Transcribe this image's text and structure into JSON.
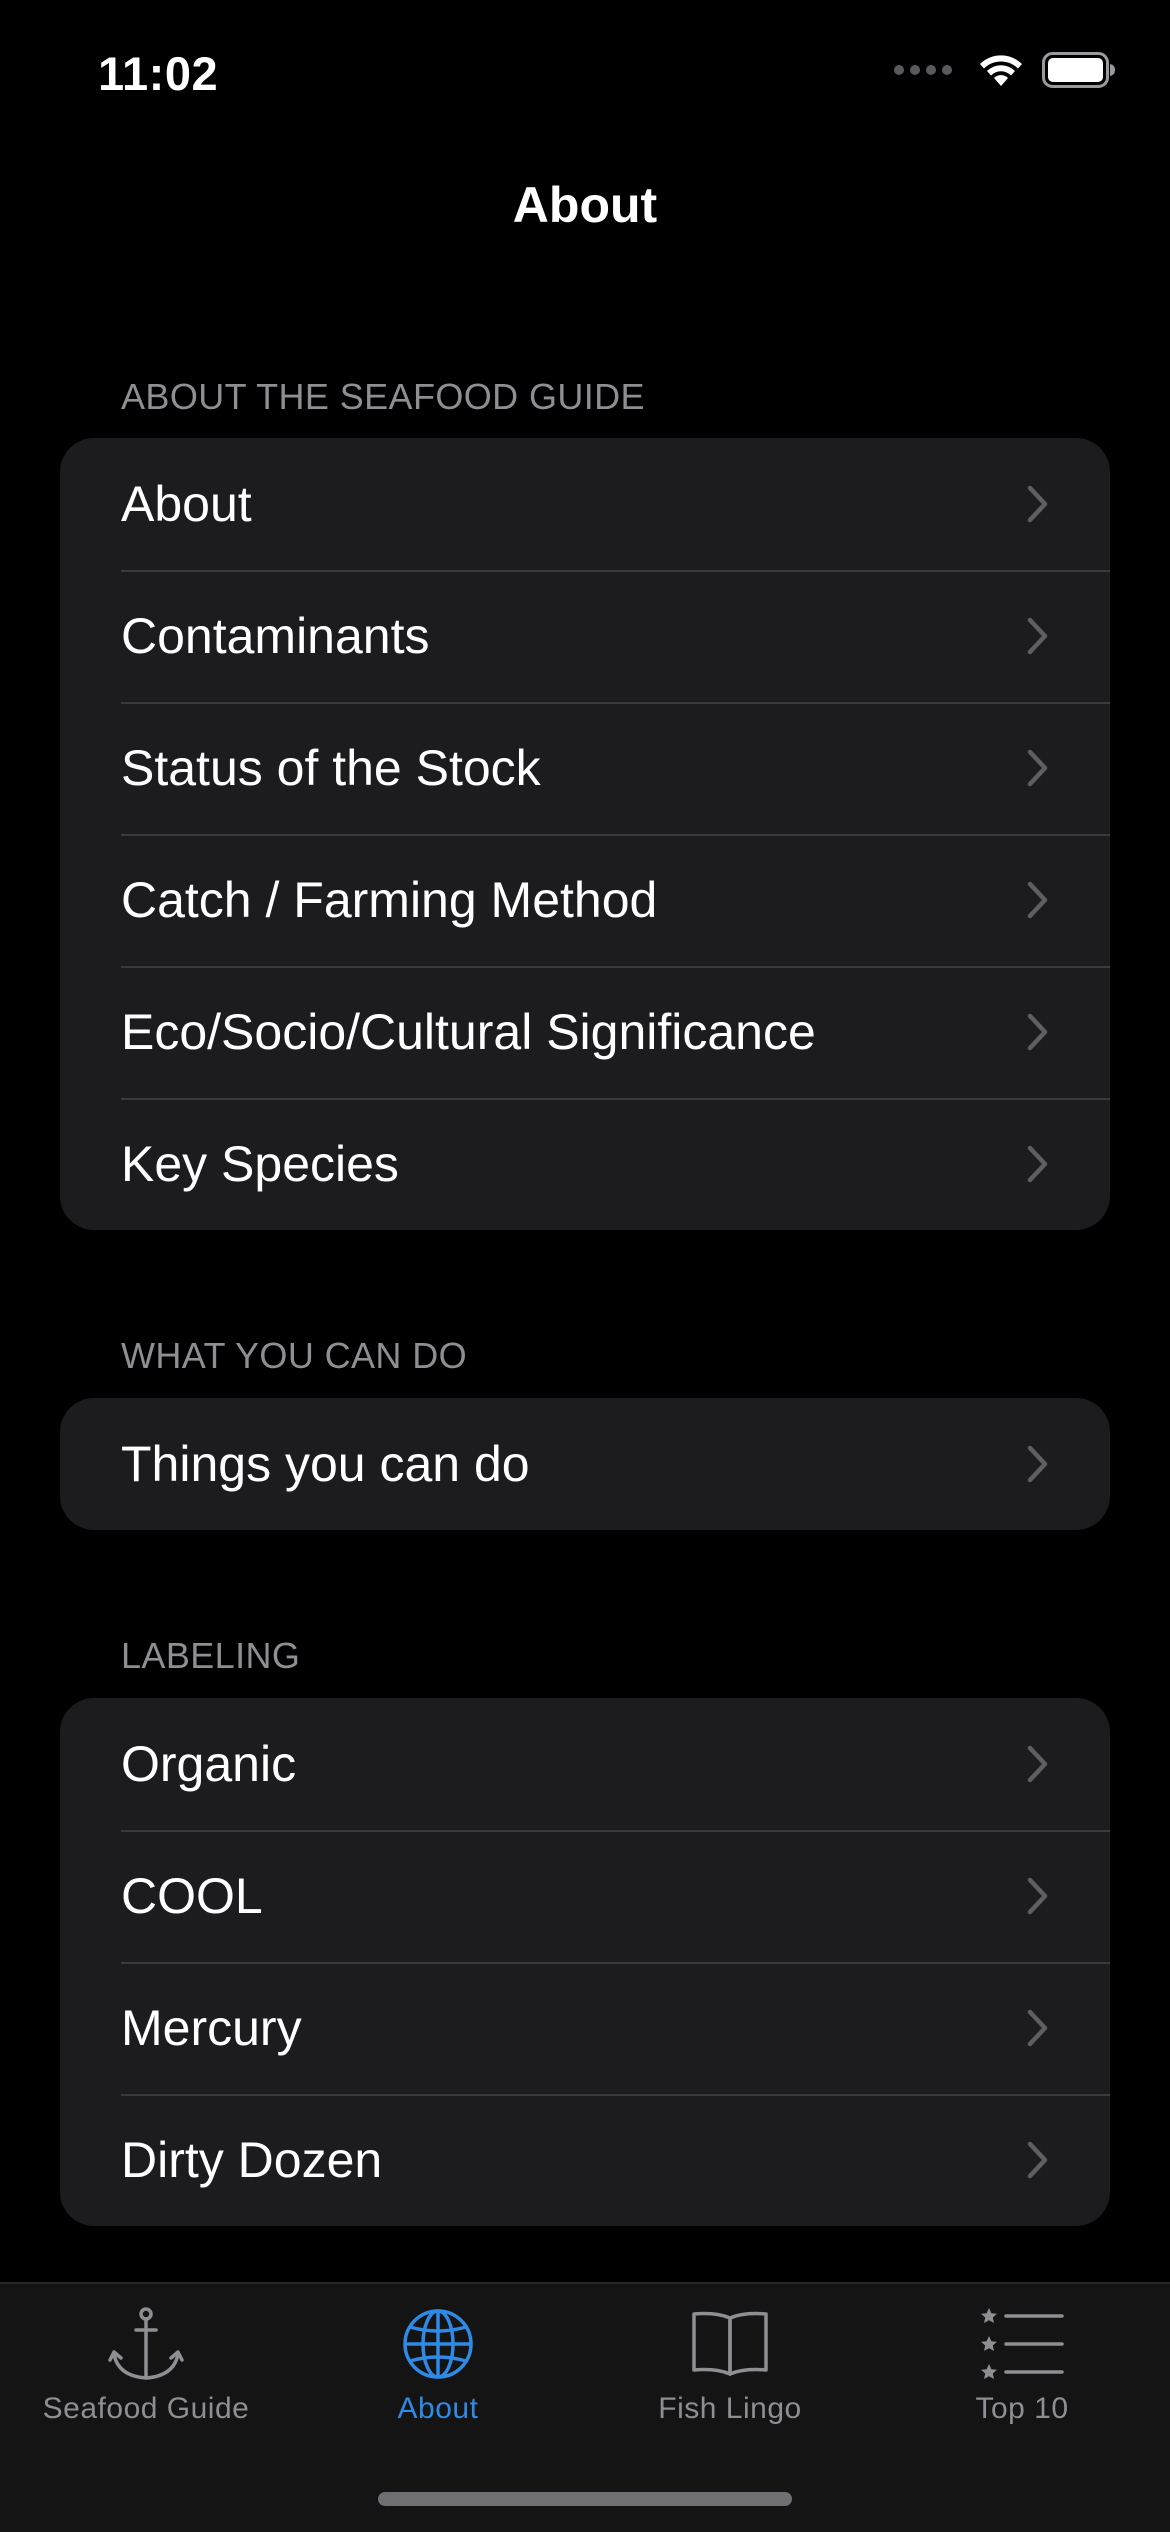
{
  "status_bar": {
    "time": "11:02"
  },
  "nav": {
    "title": "About"
  },
  "sections": [
    {
      "header": "ABOUT THE SEAFOOD GUIDE",
      "items": [
        {
          "label": "About"
        },
        {
          "label": "Contaminants"
        },
        {
          "label": "Status of the Stock"
        },
        {
          "label": "Catch / Farming Method"
        },
        {
          "label": "Eco/Socio/Cultural Significance"
        },
        {
          "label": "Key Species"
        }
      ]
    },
    {
      "header": "WHAT YOU CAN DO",
      "items": [
        {
          "label": "Things you can do"
        }
      ]
    },
    {
      "header": "LABELING",
      "items": [
        {
          "label": "Organic"
        },
        {
          "label": "COOL"
        },
        {
          "label": "Mercury"
        },
        {
          "label": "Dirty Dozen"
        }
      ]
    }
  ],
  "tab_bar": {
    "tabs": [
      {
        "label": "Seafood Guide",
        "icon": "anchor-icon",
        "active": false
      },
      {
        "label": "About",
        "icon": "globe-icon",
        "active": true
      },
      {
        "label": "Fish Lingo",
        "icon": "book-icon",
        "active": false
      },
      {
        "label": "Top 10",
        "icon": "star-list-icon",
        "active": false
      }
    ]
  },
  "colors": {
    "background": "#000000",
    "group_background": "#1c1c1e",
    "separator": "#3a3a3c",
    "secondary_text": "#8e8e93",
    "accent": "#2f8ae6"
  }
}
